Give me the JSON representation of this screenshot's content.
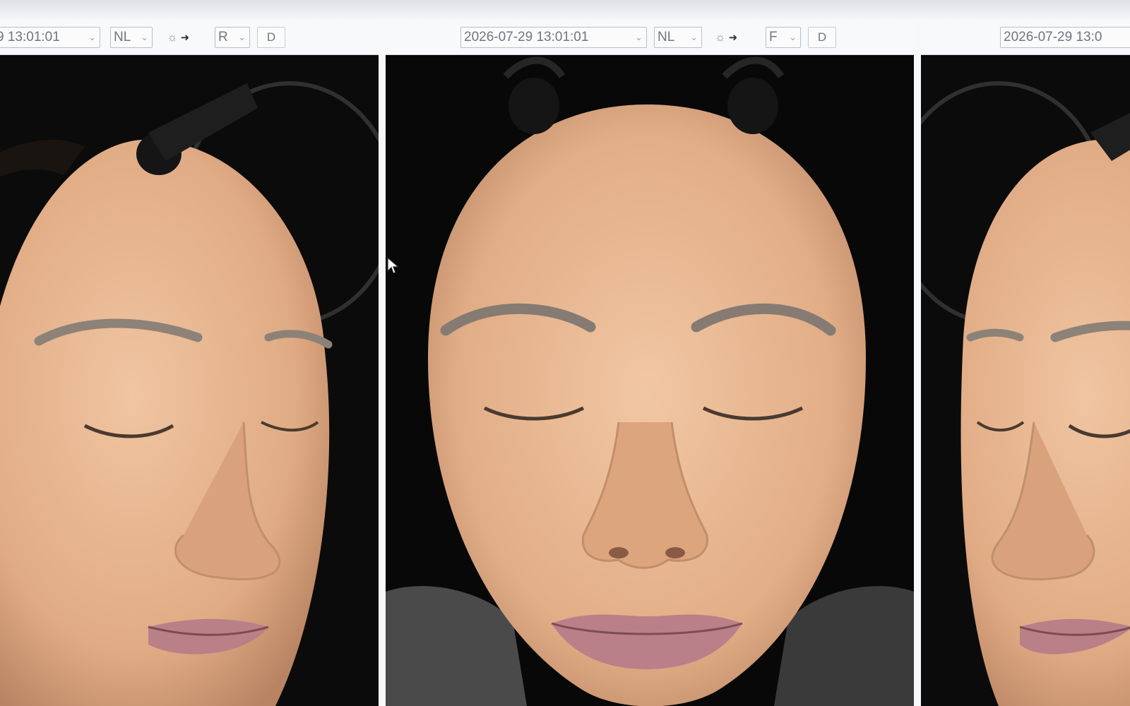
{
  "window": {
    "panels": [
      {
        "id": "left",
        "datetime": "9 13:01:01",
        "light_mode": "NL",
        "side": "R",
        "d_label": "D"
      },
      {
        "id": "center",
        "datetime": "2026-07-29 13:01:01",
        "light_mode": "NL",
        "side": "F",
        "d_label": "D"
      },
      {
        "id": "right",
        "datetime": "2026-07-29 13:0",
        "light_mode": "",
        "side": "",
        "d_label": ""
      }
    ]
  },
  "icons": {
    "light": "lightbulb-icon",
    "next": "arrow-right-icon",
    "dropdown": "chevron-down-icon",
    "cursor": "mouse-pointer-icon"
  },
  "colors": {
    "background": "#0a0a0a",
    "skin": "#e7b68d",
    "toolbar": "#f8f9fa"
  }
}
